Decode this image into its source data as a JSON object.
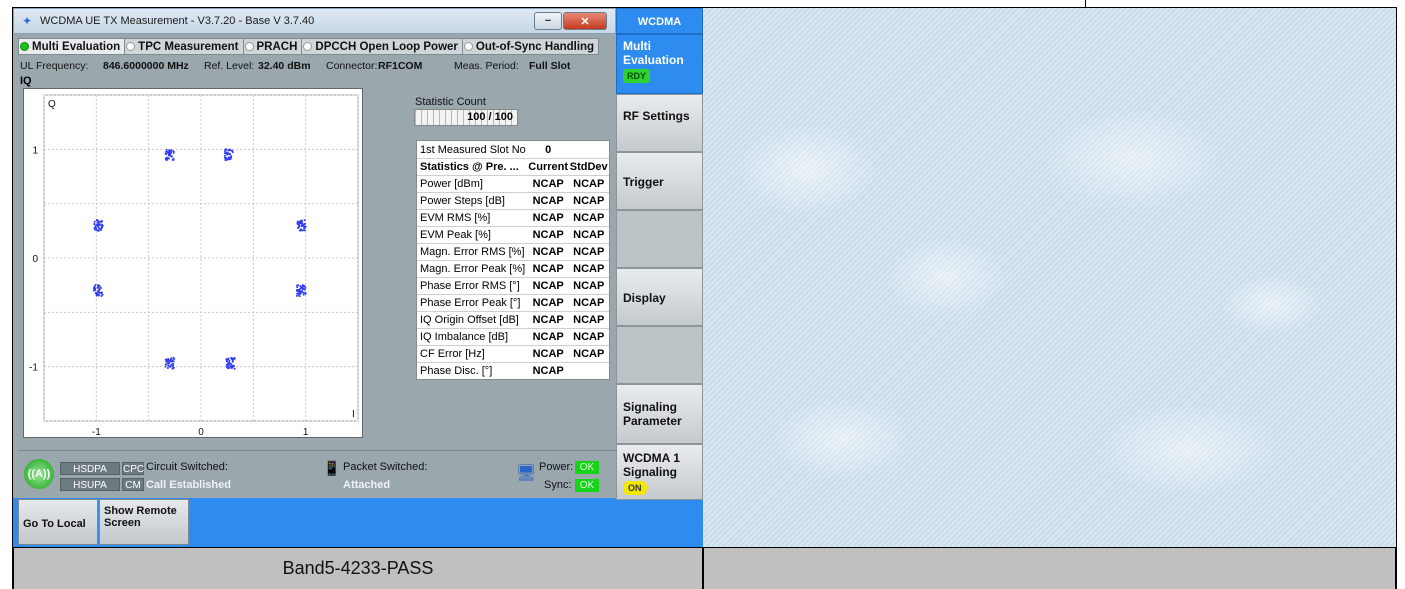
{
  "window": {
    "title": "WCDMA UE TX Measurement  - V3.7.20 - Base V 3.7.40",
    "minimize": "−",
    "close": "✕"
  },
  "tabs": [
    {
      "label": "Multi Evaluation",
      "active": true
    },
    {
      "label": "TPC Measurement",
      "active": false
    },
    {
      "label": "PRACH",
      "active": false
    },
    {
      "label": "DPCCH Open Loop Power",
      "active": false
    },
    {
      "label": "Out-of-Sync Handling",
      "active": false
    }
  ],
  "info": {
    "ul_freq_label": "UL Frequency:",
    "ul_freq_value": "846.6000000 MHz",
    "ref_level_label": "Ref. Level:",
    "ref_level_value": "32.40 dBm",
    "connector_label": "Connector:",
    "connector_value": "RF1COM",
    "meas_period_label": "Meas. Period:",
    "meas_period_value": "Full Slot"
  },
  "iq": {
    "title": "IQ",
    "q_axis_label": "Q",
    "i_axis_label": "I",
    "x_ticks": [
      "-1",
      "0",
      "1"
    ],
    "y_ticks": [
      "1",
      "0",
      "-1"
    ]
  },
  "chart_data": {
    "type": "scatter",
    "title": "IQ",
    "xlabel": "I",
    "ylabel": "Q",
    "xlim": [
      -1.5,
      1.5
    ],
    "ylim": [
      -1.5,
      1.5
    ],
    "grid": true,
    "series": [
      {
        "color": "#2e3cf0",
        "points": [
          {
            "x": -0.3,
            "y": 0.95
          },
          {
            "x": 0.27,
            "y": 0.95
          },
          {
            "x": -0.98,
            "y": 0.3
          },
          {
            "x": 0.96,
            "y": 0.3
          },
          {
            "x": -0.98,
            "y": -0.3
          },
          {
            "x": 0.96,
            "y": -0.3
          },
          {
            "x": -0.3,
            "y": -0.97
          },
          {
            "x": 0.28,
            "y": -0.97
          }
        ]
      }
    ]
  },
  "statistics": {
    "label": "Statistic Count",
    "value_text": "100 / 100",
    "progress": 1.0
  },
  "results": {
    "first_slot_label": "1st Measured Slot No",
    "first_slot_value": "0",
    "header": {
      "name": "Statistics @ Pre. ...",
      "current": "Current",
      "stddev": "StdDev"
    },
    "rows": [
      {
        "name": "Power [dBm]",
        "current": "NCAP",
        "stddev": "NCAP"
      },
      {
        "name": "Power Steps [dB]",
        "current": "NCAP",
        "stddev": "NCAP"
      },
      {
        "name": "EVM RMS [%]",
        "current": "NCAP",
        "stddev": "NCAP"
      },
      {
        "name": "EVM Peak [%]",
        "current": "NCAP",
        "stddev": "NCAP"
      },
      {
        "name": "Magn. Error RMS [%]",
        "current": "NCAP",
        "stddev": "NCAP"
      },
      {
        "name": "Magn. Error Peak [%]",
        "current": "NCAP",
        "stddev": "NCAP"
      },
      {
        "name": "Phase Error RMS [°]",
        "current": "NCAP",
        "stddev": "NCAP"
      },
      {
        "name": "Phase Error Peak [°]",
        "current": "NCAP",
        "stddev": "NCAP"
      },
      {
        "name": "IQ Origin Offset [dB]",
        "current": "NCAP",
        "stddev": "NCAP"
      },
      {
        "name": "IQ Imbalance [dB]",
        "current": "NCAP",
        "stddev": "NCAP"
      },
      {
        "name": "CF Error [Hz]",
        "current": "NCAP",
        "stddev": "NCAP"
      },
      {
        "name": "Phase Disc. [°]",
        "current": "NCAP",
        "stddev": ""
      }
    ]
  },
  "status": {
    "hsdpa": "HSDPA",
    "hsupa": "HSUPA",
    "cpc": "CPC",
    "cm": "CM",
    "circuit_label": "Circuit Switched:",
    "circuit_value": "Call Established",
    "packet_label": "Packet Switched:",
    "packet_value": "Attached",
    "power_label": "Power:",
    "power_value": "OK",
    "sync_label": "Sync:",
    "sync_value": "OK"
  },
  "softkeys": {
    "header": "WCDMA",
    "multi_evaluation": "Multi Evaluation",
    "rdy": "RDY",
    "rf_settings": "RF Settings",
    "trigger": "Trigger",
    "display": "Display",
    "signaling_parameter": "Signaling Parameter",
    "wcdma_signaling": "WCDMA 1 Signaling",
    "on": "ON"
  },
  "bottom": {
    "go_to_local": "Go To Local",
    "show_remote_screen": "Show Remote Screen"
  },
  "caption": {
    "left": "Band5-4233-PASS",
    "right": ""
  },
  "colors": {
    "accent_blue": "#2e8bf0",
    "ok_green": "#18d418",
    "iq_points": "#2e3cf0"
  }
}
